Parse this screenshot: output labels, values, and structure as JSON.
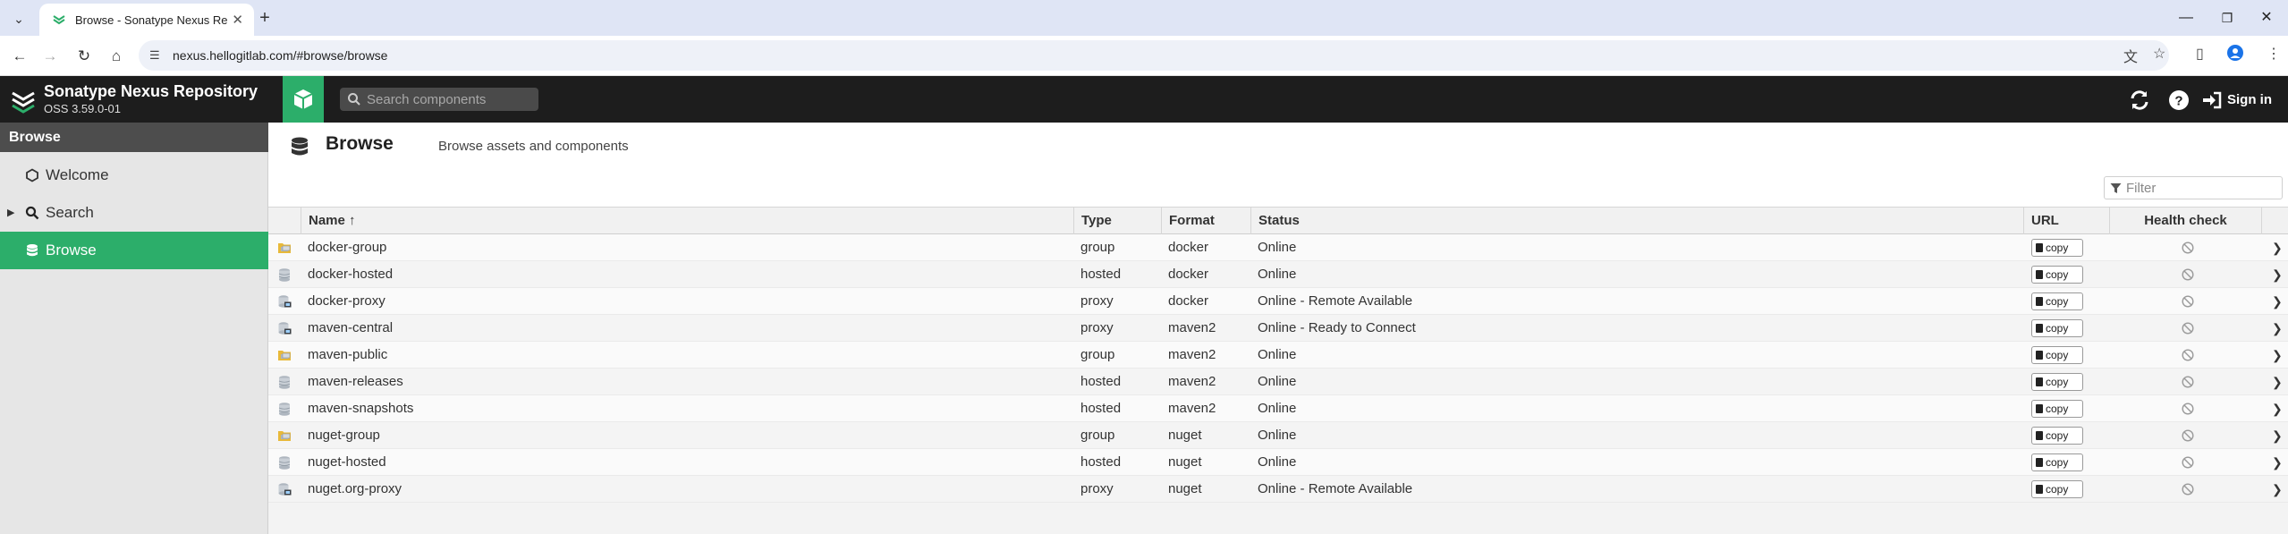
{
  "browser": {
    "tab_title": "Browse - Sonatype Nexus Re",
    "url": "nexus.hellogitlab.com/#browse/browse"
  },
  "header": {
    "app_name": "Sonatype Nexus Repository",
    "version": "OSS 3.59.0-01",
    "search_placeholder": "Search components",
    "sign_in_label": "Sign in"
  },
  "sidebar": {
    "section_title": "Browse",
    "items": [
      {
        "label": "Welcome",
        "icon": "hexagon-icon"
      },
      {
        "label": "Search",
        "icon": "search-icon"
      },
      {
        "label": "Browse",
        "icon": "database-icon",
        "active": true
      }
    ]
  },
  "page": {
    "title": "Browse",
    "subtitle": "Browse assets and components",
    "filter_placeholder": "Filter"
  },
  "table": {
    "columns": {
      "name": "Name ↑",
      "type": "Type",
      "format": "Format",
      "status": "Status",
      "url": "URL",
      "health": "Health check"
    },
    "copy_label": "copy",
    "rows": [
      {
        "name": "docker-group",
        "type": "group",
        "format": "docker",
        "status": "Online"
      },
      {
        "name": "docker-hosted",
        "type": "hosted",
        "format": "docker",
        "status": "Online"
      },
      {
        "name": "docker-proxy",
        "type": "proxy",
        "format": "docker",
        "status": "Online - Remote Available"
      },
      {
        "name": "maven-central",
        "type": "proxy",
        "format": "maven2",
        "status": "Online - Ready to Connect"
      },
      {
        "name": "maven-public",
        "type": "group",
        "format": "maven2",
        "status": "Online"
      },
      {
        "name": "maven-releases",
        "type": "hosted",
        "format": "maven2",
        "status": "Online"
      },
      {
        "name": "maven-snapshots",
        "type": "hosted",
        "format": "maven2",
        "status": "Online"
      },
      {
        "name": "nuget-group",
        "type": "group",
        "format": "nuget",
        "status": "Online"
      },
      {
        "name": "nuget-hosted",
        "type": "hosted",
        "format": "nuget",
        "status": "Online"
      },
      {
        "name": "nuget.org-proxy",
        "type": "proxy",
        "format": "nuget",
        "status": "Online - Remote Available"
      }
    ]
  },
  "colors": {
    "accent_green": "#2cae6a",
    "header_dark": "#1d1d1d",
    "sidebar_head": "#4d4d4d"
  }
}
